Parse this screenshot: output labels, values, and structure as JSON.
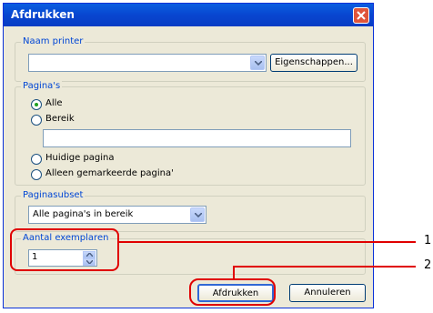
{
  "dialog": {
    "title": "Afdrukken",
    "printer_group": {
      "legend": "Naam printer",
      "selected": "",
      "properties_button": "Eigenschappen..."
    },
    "pages_group": {
      "legend": "Pagina's",
      "options": [
        {
          "label": "Alle",
          "checked": true
        },
        {
          "label": "Bereik",
          "checked": false
        },
        {
          "label": "Huidige pagina",
          "checked": false
        },
        {
          "label": "Alleen gemarkeerde pagina'",
          "checked": false
        }
      ],
      "range_value": ""
    },
    "subset_group": {
      "legend": "Paginasubset",
      "selected": "Alle pagina's in bereik"
    },
    "copies_group": {
      "legend": "Aantal exemplaren",
      "value": "1"
    },
    "print_button": "Afdrukken",
    "cancel_button": "Annuleren"
  },
  "callouts": [
    "1",
    "2"
  ],
  "colors": {
    "titlebar": "#0846d0",
    "highlight": "#e00000",
    "legend": "#0046d5"
  }
}
